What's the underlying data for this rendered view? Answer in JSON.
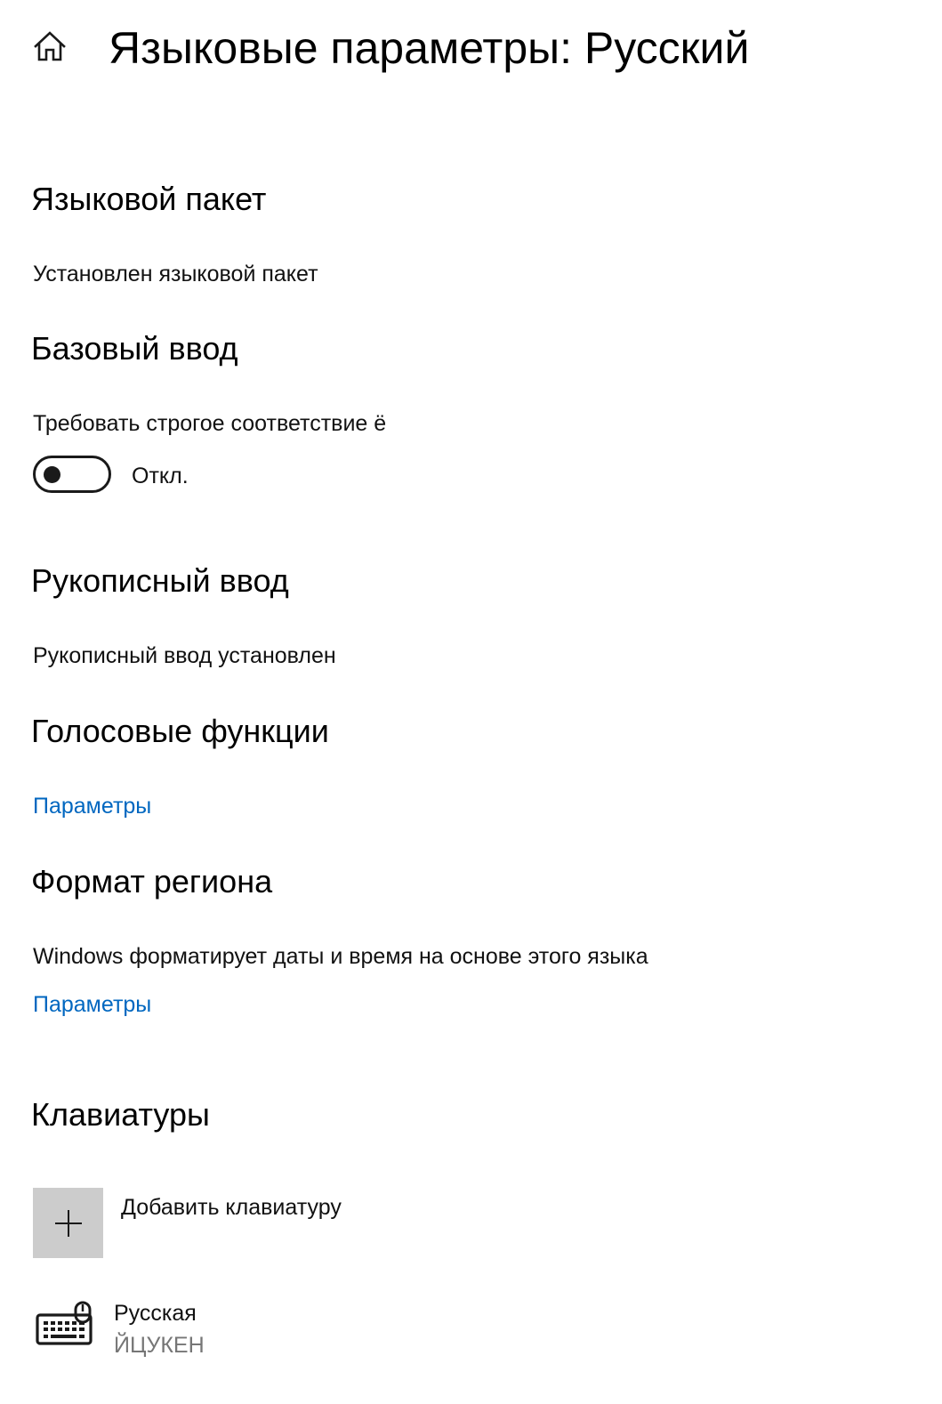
{
  "header": {
    "home_icon": "home-icon",
    "title": "Языковые параметры: Русский"
  },
  "language_pack": {
    "heading": "Языковой пакет",
    "status": "Установлен языковой пакет"
  },
  "basic_input": {
    "heading": "Базовый ввод",
    "setting_label": "Требовать строгое соответствие ё",
    "toggle_state": "Откл.",
    "toggle_on": false
  },
  "handwriting": {
    "heading": "Рукописный ввод",
    "status": "Рукописный ввод установлен"
  },
  "speech": {
    "heading": "Голосовые функции",
    "link": "Параметры"
  },
  "region_format": {
    "heading": "Формат региона",
    "description": "Windows форматирует даты и время на основе этого языка",
    "link": "Параметры"
  },
  "keyboards": {
    "heading": "Клавиатуры",
    "add_label": "Добавить клавиатуру",
    "add_icon": "plus-icon",
    "items": [
      {
        "icon": "keyboard-icon",
        "name": "Русская",
        "layout": "ЙЦУКЕН"
      }
    ]
  },
  "colors": {
    "link": "#0067c0",
    "add_tile_bg": "#cccccc",
    "secondary_text": "#767676"
  }
}
